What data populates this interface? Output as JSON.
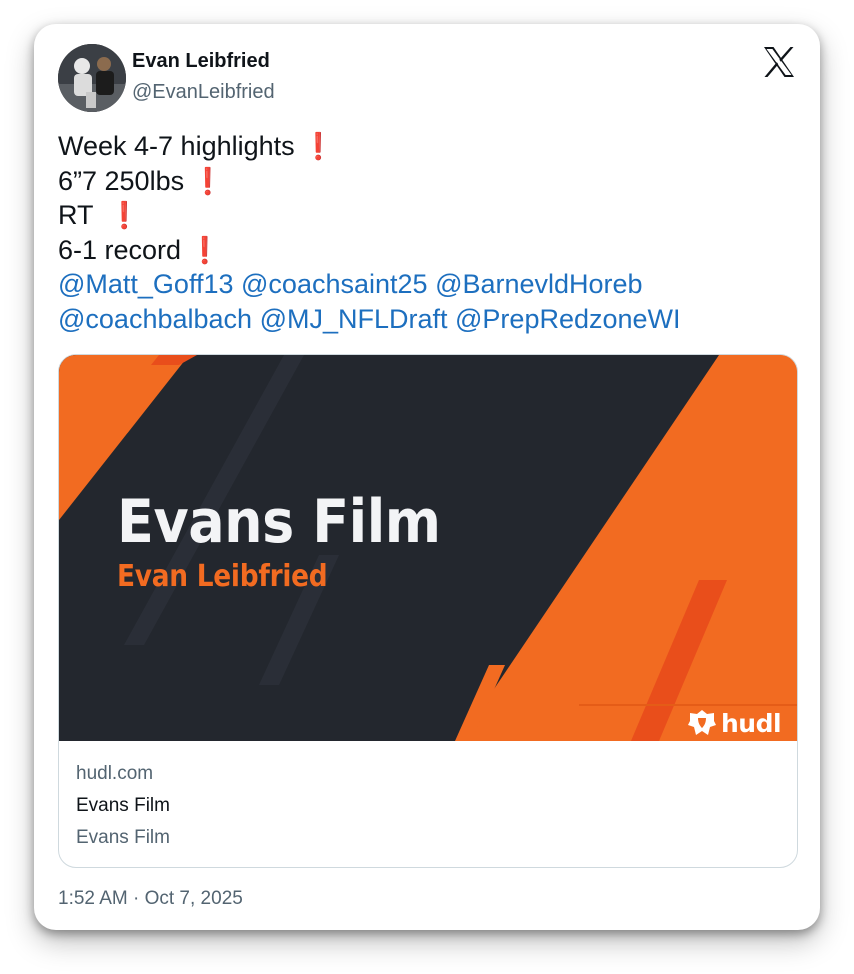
{
  "author": {
    "name": "Evan Leibfried",
    "handle": "@EvanLeibfried"
  },
  "tweet": {
    "lines": [
      {
        "text": "Week 4-7 highlights ",
        "emoji": "❗"
      },
      {
        "text": "6”7 250lbs ",
        "emoji": "❗"
      },
      {
        "text": "RT  ",
        "emoji": "❗"
      },
      {
        "text": "6-1 record ",
        "emoji": "❗"
      }
    ],
    "mentions_line1": [
      "@Matt_Goff13",
      "@coachsaint25",
      "@BarnevldHoreb"
    ],
    "mentions_line2": [
      "@coachbalbach",
      "@MJ_NFLDraft",
      "@PrepRedzoneWI"
    ]
  },
  "link_card": {
    "banner_title": "Evans Film",
    "banner_subtitle": "Evan Leibfried",
    "brand": "hudl",
    "domain": "hudl.com",
    "title": "Evans Film",
    "description": "Evans Film"
  },
  "timestamp": "1:52 AM · Oct 7, 2025",
  "colors": {
    "mention": "#1d6fbf",
    "banner_orange": "#f26b21",
    "banner_dark": "#23272e",
    "emoji_red": "#d31a2b"
  },
  "icons": [
    "x-logo-icon",
    "exclamation-icon",
    "hudl-logo-icon"
  ]
}
